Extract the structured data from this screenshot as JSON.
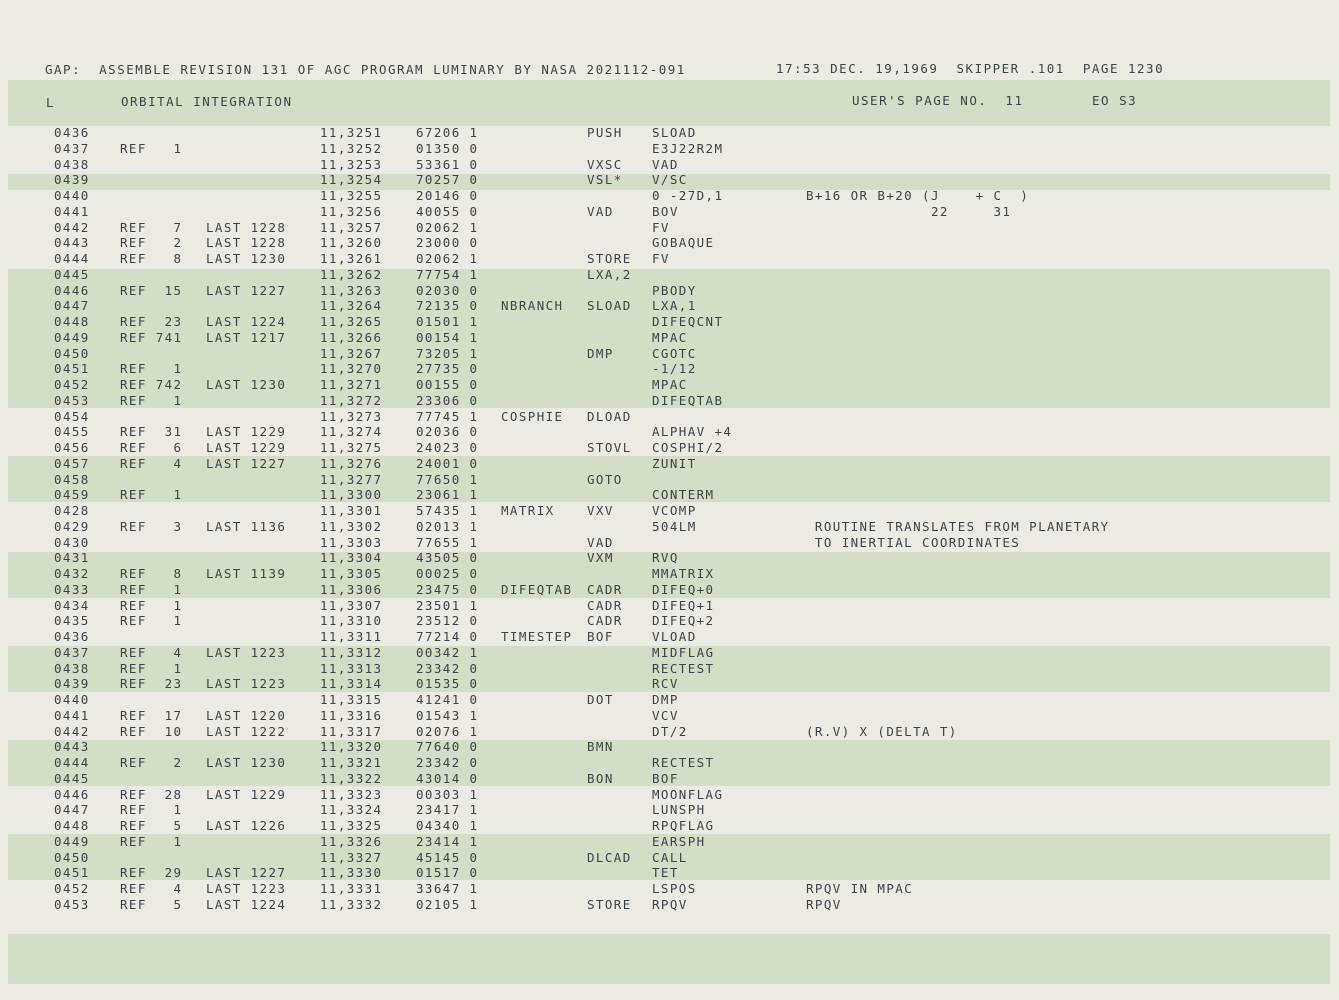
{
  "header": {
    "title": "GAP:  ASSEMBLE REVISION 131 OF AGC PROGRAM LUMINARY BY NASA 2021112-091",
    "stamp": "17:53 DEC. 19,1969  SKIPPER .101  PAGE 1230"
  },
  "subheader": {
    "left": "L",
    "section": "ORBITAL INTEGRATION",
    "user_page": "USER'S PAGE NO.  11",
    "eo": "EO S3"
  },
  "rows": [
    {
      "line": "0436",
      "ref": "",
      "last": "",
      "addr": "11,3251",
      "word": "67206 1",
      "label": "",
      "op": "PUSH",
      "operand": "SLOAD",
      "comment": ""
    },
    {
      "line": "0437",
      "ref": "REF   1",
      "last": "",
      "addr": "11,3252",
      "word": "01350 0",
      "label": "",
      "op": "",
      "operand": "E3J22R2M",
      "comment": ""
    },
    {
      "line": "0438",
      "ref": "",
      "last": "",
      "addr": "11,3253",
      "word": "53361 0",
      "label": "",
      "op": "VXSC",
      "operand": "VAD",
      "comment": ""
    },
    {
      "line": "0439",
      "ref": "",
      "last": "",
      "addr": "11,3254",
      "word": "70257 0",
      "label": "",
      "op": "VSL*",
      "operand": "V/SC",
      "comment": ""
    },
    {
      "line": "0440",
      "ref": "",
      "last": "",
      "addr": "11,3255",
      "word": "20146 0",
      "label": "",
      "op": "",
      "operand": "0 -27D,1",
      "comment": "B+16 OR B+20 (J    + C  )"
    },
    {
      "line": "0441",
      "ref": "",
      "last": "",
      "addr": "11,3256",
      "word": "40055 0",
      "label": "",
      "op": "VAD",
      "operand": "BOV",
      "comment": "              22     31"
    },
    {
      "line": "0442",
      "ref": "REF   7",
      "last": "LAST 1228",
      "addr": "11,3257",
      "word": "02062 1",
      "label": "",
      "op": "",
      "operand": "FV",
      "comment": ""
    },
    {
      "line": "0443",
      "ref": "REF   2",
      "last": "LAST 1228",
      "addr": "11,3260",
      "word": "23000 0",
      "label": "",
      "op": "",
      "operand": "GOBAQUE",
      "comment": ""
    },
    {
      "line": "0444",
      "ref": "REF   8",
      "last": "LAST 1230",
      "addr": "11,3261",
      "word": "02062 1",
      "label": "",
      "op": "STORE",
      "operand": "FV",
      "comment": ""
    },
    {
      "line": "0445",
      "ref": "",
      "last": "",
      "addr": "11,3262",
      "word": "77754 1",
      "label": "",
      "op": "LXA,2",
      "operand": "",
      "comment": ""
    },
    {
      "line": "0446",
      "ref": "REF  15",
      "last": "LAST 1227",
      "addr": "11,3263",
      "word": "02030 0",
      "label": "",
      "op": "",
      "operand": "PBODY",
      "comment": ""
    },
    {
      "line": "0447",
      "ref": "",
      "last": "",
      "addr": "11,3264",
      "word": "72135 0",
      "label": "NBRANCH",
      "op": "SLOAD",
      "operand": "LXA,1",
      "comment": ""
    },
    {
      "line": "0448",
      "ref": "REF  23",
      "last": "LAST 1224",
      "addr": "11,3265",
      "word": "01501 1",
      "label": "",
      "op": "",
      "operand": "DIFEQCNT",
      "comment": ""
    },
    {
      "line": "0449",
      "ref": "REF 741",
      "last": "LAST 1217",
      "addr": "11,3266",
      "word": "00154 1",
      "label": "",
      "op": "",
      "operand": "MPAC",
      "comment": ""
    },
    {
      "line": "0450",
      "ref": "",
      "last": "",
      "addr": "11,3267",
      "word": "73205 1",
      "label": "",
      "op": "DMP",
      "operand": "CGOTC",
      "comment": ""
    },
    {
      "line": "0451",
      "ref": "REF   1",
      "last": "",
      "addr": "11,3270",
      "word": "27735 0",
      "label": "",
      "op": "",
      "operand": "-1/12",
      "comment": ""
    },
    {
      "line": "0452",
      "ref": "REF 742",
      "last": "LAST 1230",
      "addr": "11,3271",
      "word": "00155 0",
      "label": "",
      "op": "",
      "operand": "MPAC",
      "comment": ""
    },
    {
      "line": "0453",
      "ref": "REF   1",
      "last": "",
      "addr": "11,3272",
      "word": "23306 0",
      "label": "",
      "op": "",
      "operand": "DIFEQTAB",
      "comment": ""
    },
    {
      "line": "0454",
      "ref": "",
      "last": "",
      "addr": "11,3273",
      "word": "77745 1",
      "label": "COSPHIE",
      "op": "DLOAD",
      "operand": "",
      "comment": ""
    },
    {
      "line": "0455",
      "ref": "REF  31",
      "last": "LAST 1229",
      "addr": "11,3274",
      "word": "02036 0",
      "label": "",
      "op": "",
      "operand": "ALPHAV +4",
      "comment": ""
    },
    {
      "line": "0456",
      "ref": "REF   6",
      "last": "LAST 1229",
      "addr": "11,3275",
      "word": "24023 0",
      "label": "",
      "op": "STOVL",
      "operand": "COSPHI/2",
      "comment": ""
    },
    {
      "line": "0457",
      "ref": "REF   4",
      "last": "LAST 1227",
      "addr": "11,3276",
      "word": "24001 0",
      "label": "",
      "op": "",
      "operand": "ZUNIT",
      "comment": ""
    },
    {
      "line": "0458",
      "ref": "",
      "last": "",
      "addr": "11,3277",
      "word": "77650 1",
      "label": "",
      "op": "GOTO",
      "operand": "",
      "comment": ""
    },
    {
      "line": "0459",
      "ref": "REF   1",
      "last": "",
      "addr": "11,3300",
      "word": "23061 1",
      "label": "",
      "op": "",
      "operand": "CONTERM",
      "comment": ""
    },
    {
      "line": "0428",
      "ref": "",
      "last": "",
      "addr": "11,3301",
      "word": "57435 1",
      "label": "MATRIX",
      "op": "VXV",
      "operand": "VCOMP",
      "comment": ""
    },
    {
      "line": "0429",
      "ref": "REF   3",
      "last": "LAST 1136",
      "addr": "11,3302",
      "word": "02013 1",
      "label": "",
      "op": "",
      "operand": "504LM",
      "comment": " ROUTINE TRANSLATES FROM PLANETARY",
      "comment2": " TO INERTIAL COORDINATES"
    },
    {
      "line": "0430",
      "ref": "",
      "last": "",
      "addr": "11,3303",
      "word": "77655 1",
      "label": "",
      "op": "VAD",
      "operand": "",
      "comment": ""
    },
    {
      "line": "0431",
      "ref": "",
      "last": "",
      "addr": "11,3304",
      "word": "43505 0",
      "label": "",
      "op": "VXM",
      "operand": "RVQ",
      "comment": ""
    },
    {
      "line": "0432",
      "ref": "REF   8",
      "last": "LAST 1139",
      "addr": "11,3305",
      "word": "00025 0",
      "label": "",
      "op": "",
      "operand": "MMATRIX",
      "comment": ""
    },
    {
      "line": "0433",
      "ref": "REF   1",
      "last": "",
      "addr": "11,3306",
      "word": "23475 0",
      "label": "DIFEQTAB",
      "op": "CADR",
      "operand": "DIFEQ+0",
      "comment": ""
    },
    {
      "line": "0434",
      "ref": "REF   1",
      "last": "",
      "addr": "11,3307",
      "word": "23501 1",
      "label": "",
      "op": "CADR",
      "operand": "DIFEQ+1",
      "comment": ""
    },
    {
      "line": "0435",
      "ref": "REF   1",
      "last": "",
      "addr": "11,3310",
      "word": "23512 0",
      "label": "",
      "op": "CADR",
      "operand": "DIFEQ+2",
      "comment": ""
    },
    {
      "line": "0436",
      "ref": "",
      "last": "",
      "addr": "11,3311",
      "word": "77214 0",
      "label": "TIMESTEP",
      "op": "BOF",
      "operand": "VLOAD",
      "comment": ""
    },
    {
      "line": "0437",
      "ref": "REF   4",
      "last": "LAST 1223",
      "addr": "11,3312",
      "word": "00342 1",
      "label": "",
      "op": "",
      "operand": "MIDFLAG",
      "comment": ""
    },
    {
      "line": "0438",
      "ref": "REF   1",
      "last": "",
      "addr": "11,3313",
      "word": "23342 0",
      "label": "",
      "op": "",
      "operand": "RECTEST",
      "comment": ""
    },
    {
      "line": "0439",
      "ref": "REF  23",
      "last": "LAST 1223",
      "addr": "11,3314",
      "word": "01535 0",
      "label": "",
      "op": "",
      "operand": "RCV",
      "comment": ""
    },
    {
      "line": "0440",
      "ref": "",
      "last": "",
      "addr": "11,3315",
      "word": "41241 0",
      "label": "",
      "op": "DOT",
      "operand": "DMP",
      "comment": ""
    },
    {
      "line": "0441",
      "ref": "REF  17",
      "last": "LAST 1220",
      "addr": "11,3316",
      "word": "01543 1",
      "label": "",
      "op": "",
      "operand": "VCV",
      "comment": ""
    },
    {
      "line": "0442",
      "ref": "REF  10",
      "last": "LAST 1222",
      "addr": "11,3317",
      "word": "02076 1",
      "label": "",
      "op": "",
      "operand": "DT/2",
      "comment": "(R.V) X (DELTA T)"
    },
    {
      "line": "0443",
      "ref": "",
      "last": "",
      "addr": "11,3320",
      "word": "77640 0",
      "label": "",
      "op": "BMN",
      "operand": "",
      "comment": ""
    },
    {
      "line": "0444",
      "ref": "REF   2",
      "last": "LAST 1230",
      "addr": "11,3321",
      "word": "23342 0",
      "label": "",
      "op": "",
      "operand": "RECTEST",
      "comment": ""
    },
    {
      "line": "0445",
      "ref": "",
      "last": "",
      "addr": "11,3322",
      "word": "43014 0",
      "label": "",
      "op": "BON",
      "operand": "BOF",
      "comment": ""
    },
    {
      "line": "0446",
      "ref": "REF  28",
      "last": "LAST 1229",
      "addr": "11,3323",
      "word": "00303 1",
      "label": "",
      "op": "",
      "operand": "MOONFLAG",
      "comment": ""
    },
    {
      "line": "0447",
      "ref": "REF   1",
      "last": "",
      "addr": "11,3324",
      "word": "23417 1",
      "label": "",
      "op": "",
      "operand": "LUNSPH",
      "comment": ""
    },
    {
      "line": "0448",
      "ref": "REF   5",
      "last": "LAST 1226",
      "addr": "11,3325",
      "word": "04340 1",
      "label": "",
      "op": "",
      "operand": "RPQFLAG",
      "comment": ""
    },
    {
      "line": "0449",
      "ref": "REF   1",
      "last": "",
      "addr": "11,3326",
      "word": "23414 1",
      "label": "",
      "op": "",
      "operand": "EARSPH",
      "comment": ""
    },
    {
      "line": "0450",
      "ref": "",
      "last": "",
      "addr": "11,3327",
      "word": "45145 0",
      "label": "",
      "op": "DLCAD",
      "operand": "CALL",
      "comment": ""
    },
    {
      "line": "0451",
      "ref": "REF  29",
      "last": "LAST 1227",
      "addr": "11,3330",
      "word": "01517 0",
      "label": "",
      "op": "",
      "operand": "TET",
      "comment": ""
    },
    {
      "line": "0452",
      "ref": "REF   4",
      "last": "LAST 1223",
      "addr": "11,3331",
      "word": "33647 1",
      "label": "",
      "op": "",
      "operand": "LSPOS",
      "comment": "RPQV IN MPAC"
    },
    {
      "line": "0453",
      "ref": "REF   5",
      "last": "LAST 1224",
      "addr": "11,3332",
      "word": "02105 1",
      "label": "",
      "op": "STORE",
      "operand": "RPQV",
      "comment": "RPQV"
    }
  ]
}
